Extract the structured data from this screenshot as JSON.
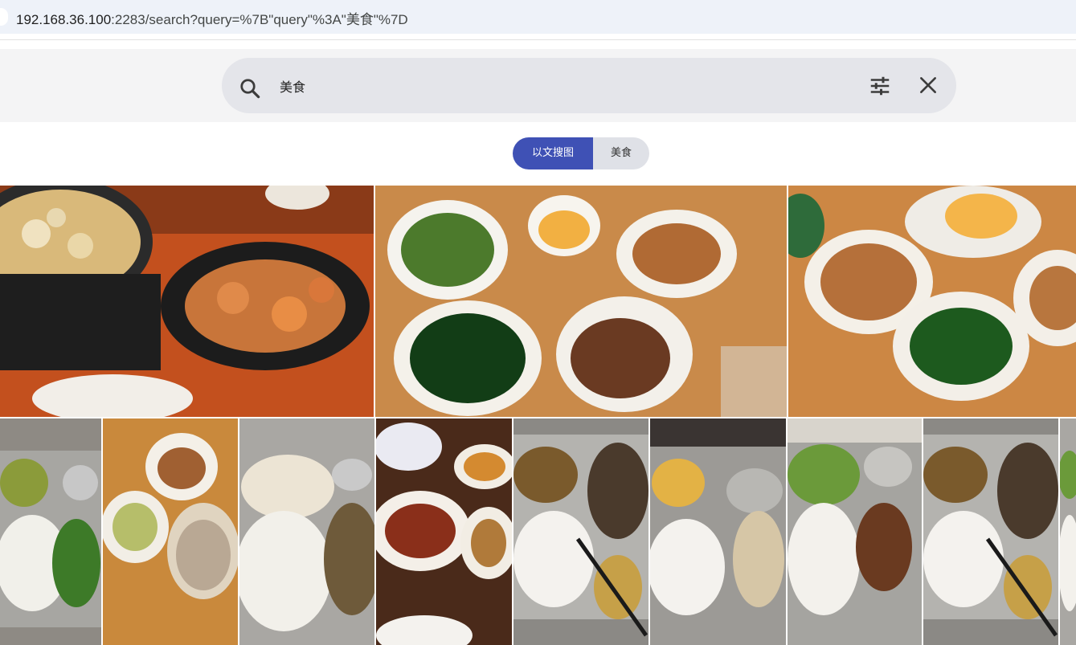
{
  "browser": {
    "url_host": "192.168.36.100",
    "url_rest": ":2283/search?query=%7B\"query\"%3A\"美食\"%7D"
  },
  "search": {
    "value": "美食",
    "placeholder": "",
    "icons": [
      "search-icon",
      "filter-icon",
      "close-icon"
    ]
  },
  "filters": {
    "type_label": "以文搜图",
    "term_label": "美食",
    "active_color": "#3f51b5"
  },
  "results": {
    "row1_count": 3,
    "row2_count": 8,
    "subjects": [
      "food"
    ]
  }
}
